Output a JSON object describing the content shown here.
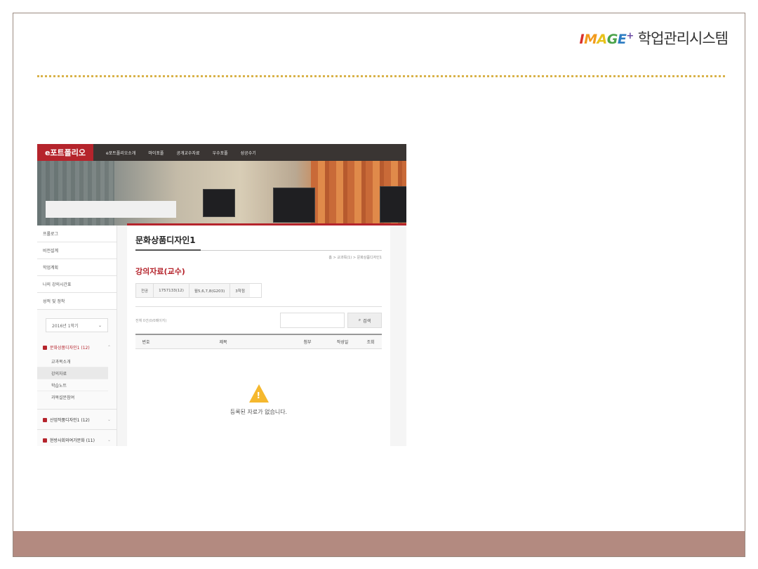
{
  "logo": {
    "brand_letters": [
      {
        "ch": "I",
        "color": "#d9302c"
      },
      {
        "ch": "M",
        "color": "#f29a1d"
      },
      {
        "ch": "A",
        "color": "#e8c21b"
      },
      {
        "ch": "G",
        "color": "#4aa34a"
      },
      {
        "ch": "E",
        "color": "#2c7cc2"
      },
      {
        "ch": "+",
        "color": "#6a4aa3"
      }
    ],
    "title": "학업관리시스템"
  },
  "portal": {
    "brand": "e포트폴리오",
    "nav": [
      "e포트폴리오소개",
      "마이포폴",
      "공개교수자료",
      "우수포폴",
      "성공수기"
    ]
  },
  "sidebar": {
    "items": [
      "프롤로그",
      "비전설계",
      "학업계획",
      "나의 강의시간표",
      "성적 및 정착"
    ],
    "semester": "2016년 1학기",
    "semester_arrow": "⌄",
    "courses": [
      {
        "label": "문화상품디자인1 (12)",
        "arrow": "⌃",
        "active": true,
        "subs": [
          "교과목소개",
          "강의자료",
          "학습노트",
          "과목설문참여"
        ]
      },
      {
        "label": "산업작품디자인1 (12)",
        "arrow": "⌄",
        "active": false,
        "subs": []
      },
      {
        "label": "현방사회와여가문화 (11)",
        "arrow": "⌄",
        "active": false,
        "subs": []
      }
    ]
  },
  "content": {
    "page_title": "문화상품디자인1",
    "breadcrumb": "홈 > 교과목(1) > 문화상품디자인1",
    "section_title": "강의자료(교수)",
    "info": [
      "전공",
      "1757133(12)",
      "월5,6,7,8(G203)",
      "3학점"
    ],
    "total": "전체 0건(0/0페이지)",
    "search_label": "검색",
    "search_icon": "⌕",
    "columns": [
      "번호",
      "제목",
      "첨부",
      "작성일",
      "조회"
    ],
    "empty_message": "등록된 자료가 없습니다."
  },
  "colors": {
    "accent": "#b5242c",
    "footer": "#b38a80",
    "dots": "#d9b24a"
  }
}
